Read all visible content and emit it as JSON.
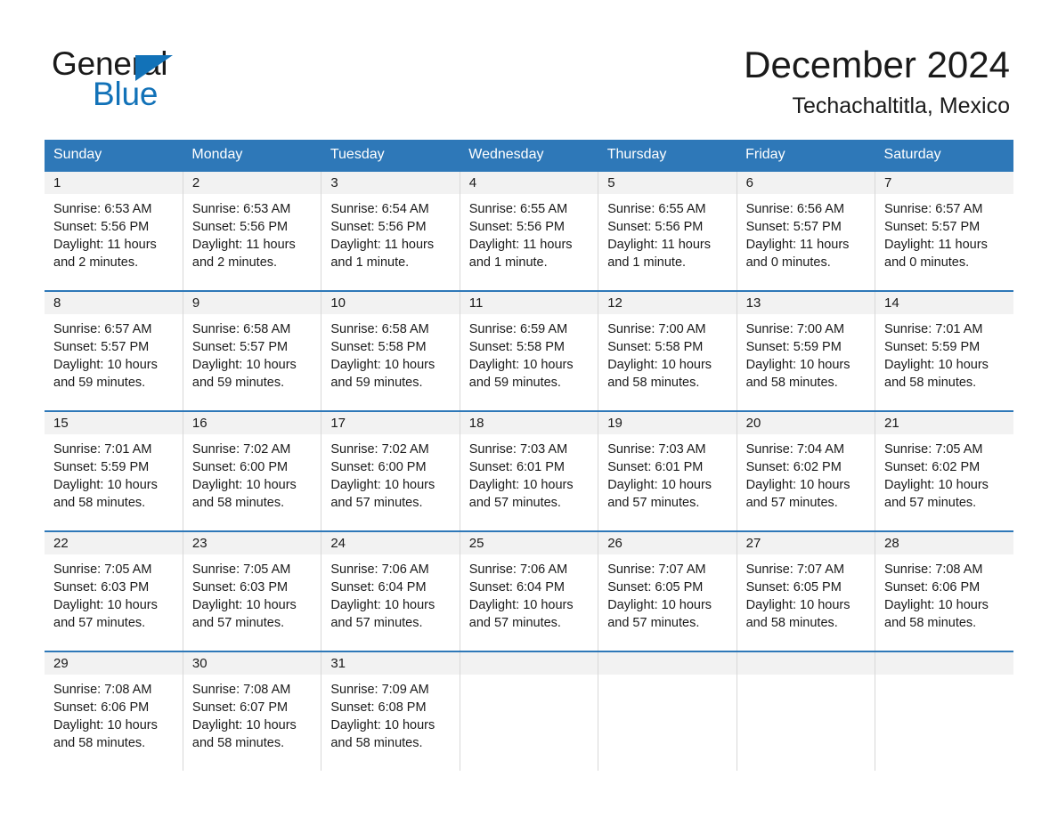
{
  "brand": {
    "name_part1": "General",
    "name_part2": "Blue",
    "logo_icon": "blue-triangle-icon"
  },
  "header": {
    "month_title": "December 2024",
    "location": "Techachaltitla, Mexico"
  },
  "colors": {
    "header_blue": "#2e78b8",
    "brand_blue": "#1272b8",
    "daynum_band": "#f2f2f2",
    "text": "#1a1a1a",
    "cell_divider": "#d8d8d8"
  },
  "weekday_headers": [
    "Sunday",
    "Monday",
    "Tuesday",
    "Wednesday",
    "Thursday",
    "Friday",
    "Saturday"
  ],
  "labels": {
    "sunrise_prefix": "Sunrise:",
    "sunset_prefix": "Sunset:",
    "daylight_prefix": "Daylight:"
  },
  "weeks": [
    [
      {
        "day": "1",
        "sunrise": "Sunrise: 6:53 AM",
        "sunset": "Sunset: 5:56 PM",
        "daylight_l1": "Daylight: 11 hours",
        "daylight_l2": "and 2 minutes."
      },
      {
        "day": "2",
        "sunrise": "Sunrise: 6:53 AM",
        "sunset": "Sunset: 5:56 PM",
        "daylight_l1": "Daylight: 11 hours",
        "daylight_l2": "and 2 minutes."
      },
      {
        "day": "3",
        "sunrise": "Sunrise: 6:54 AM",
        "sunset": "Sunset: 5:56 PM",
        "daylight_l1": "Daylight: 11 hours",
        "daylight_l2": "and 1 minute."
      },
      {
        "day": "4",
        "sunrise": "Sunrise: 6:55 AM",
        "sunset": "Sunset: 5:56 PM",
        "daylight_l1": "Daylight: 11 hours",
        "daylight_l2": "and 1 minute."
      },
      {
        "day": "5",
        "sunrise": "Sunrise: 6:55 AM",
        "sunset": "Sunset: 5:56 PM",
        "daylight_l1": "Daylight: 11 hours",
        "daylight_l2": "and 1 minute."
      },
      {
        "day": "6",
        "sunrise": "Sunrise: 6:56 AM",
        "sunset": "Sunset: 5:57 PM",
        "daylight_l1": "Daylight: 11 hours",
        "daylight_l2": "and 0 minutes."
      },
      {
        "day": "7",
        "sunrise": "Sunrise: 6:57 AM",
        "sunset": "Sunset: 5:57 PM",
        "daylight_l1": "Daylight: 11 hours",
        "daylight_l2": "and 0 minutes."
      }
    ],
    [
      {
        "day": "8",
        "sunrise": "Sunrise: 6:57 AM",
        "sunset": "Sunset: 5:57 PM",
        "daylight_l1": "Daylight: 10 hours",
        "daylight_l2": "and 59 minutes."
      },
      {
        "day": "9",
        "sunrise": "Sunrise: 6:58 AM",
        "sunset": "Sunset: 5:57 PM",
        "daylight_l1": "Daylight: 10 hours",
        "daylight_l2": "and 59 minutes."
      },
      {
        "day": "10",
        "sunrise": "Sunrise: 6:58 AM",
        "sunset": "Sunset: 5:58 PM",
        "daylight_l1": "Daylight: 10 hours",
        "daylight_l2": "and 59 minutes."
      },
      {
        "day": "11",
        "sunrise": "Sunrise: 6:59 AM",
        "sunset": "Sunset: 5:58 PM",
        "daylight_l1": "Daylight: 10 hours",
        "daylight_l2": "and 59 minutes."
      },
      {
        "day": "12",
        "sunrise": "Sunrise: 7:00 AM",
        "sunset": "Sunset: 5:58 PM",
        "daylight_l1": "Daylight: 10 hours",
        "daylight_l2": "and 58 minutes."
      },
      {
        "day": "13",
        "sunrise": "Sunrise: 7:00 AM",
        "sunset": "Sunset: 5:59 PM",
        "daylight_l1": "Daylight: 10 hours",
        "daylight_l2": "and 58 minutes."
      },
      {
        "day": "14",
        "sunrise": "Sunrise: 7:01 AM",
        "sunset": "Sunset: 5:59 PM",
        "daylight_l1": "Daylight: 10 hours",
        "daylight_l2": "and 58 minutes."
      }
    ],
    [
      {
        "day": "15",
        "sunrise": "Sunrise: 7:01 AM",
        "sunset": "Sunset: 5:59 PM",
        "daylight_l1": "Daylight: 10 hours",
        "daylight_l2": "and 58 minutes."
      },
      {
        "day": "16",
        "sunrise": "Sunrise: 7:02 AM",
        "sunset": "Sunset: 6:00 PM",
        "daylight_l1": "Daylight: 10 hours",
        "daylight_l2": "and 58 minutes."
      },
      {
        "day": "17",
        "sunrise": "Sunrise: 7:02 AM",
        "sunset": "Sunset: 6:00 PM",
        "daylight_l1": "Daylight: 10 hours",
        "daylight_l2": "and 57 minutes."
      },
      {
        "day": "18",
        "sunrise": "Sunrise: 7:03 AM",
        "sunset": "Sunset: 6:01 PM",
        "daylight_l1": "Daylight: 10 hours",
        "daylight_l2": "and 57 minutes."
      },
      {
        "day": "19",
        "sunrise": "Sunrise: 7:03 AM",
        "sunset": "Sunset: 6:01 PM",
        "daylight_l1": "Daylight: 10 hours",
        "daylight_l2": "and 57 minutes."
      },
      {
        "day": "20",
        "sunrise": "Sunrise: 7:04 AM",
        "sunset": "Sunset: 6:02 PM",
        "daylight_l1": "Daylight: 10 hours",
        "daylight_l2": "and 57 minutes."
      },
      {
        "day": "21",
        "sunrise": "Sunrise: 7:05 AM",
        "sunset": "Sunset: 6:02 PM",
        "daylight_l1": "Daylight: 10 hours",
        "daylight_l2": "and 57 minutes."
      }
    ],
    [
      {
        "day": "22",
        "sunrise": "Sunrise: 7:05 AM",
        "sunset": "Sunset: 6:03 PM",
        "daylight_l1": "Daylight: 10 hours",
        "daylight_l2": "and 57 minutes."
      },
      {
        "day": "23",
        "sunrise": "Sunrise: 7:05 AM",
        "sunset": "Sunset: 6:03 PM",
        "daylight_l1": "Daylight: 10 hours",
        "daylight_l2": "and 57 minutes."
      },
      {
        "day": "24",
        "sunrise": "Sunrise: 7:06 AM",
        "sunset": "Sunset: 6:04 PM",
        "daylight_l1": "Daylight: 10 hours",
        "daylight_l2": "and 57 minutes."
      },
      {
        "day": "25",
        "sunrise": "Sunrise: 7:06 AM",
        "sunset": "Sunset: 6:04 PM",
        "daylight_l1": "Daylight: 10 hours",
        "daylight_l2": "and 57 minutes."
      },
      {
        "day": "26",
        "sunrise": "Sunrise: 7:07 AM",
        "sunset": "Sunset: 6:05 PM",
        "daylight_l1": "Daylight: 10 hours",
        "daylight_l2": "and 57 minutes."
      },
      {
        "day": "27",
        "sunrise": "Sunrise: 7:07 AM",
        "sunset": "Sunset: 6:05 PM",
        "daylight_l1": "Daylight: 10 hours",
        "daylight_l2": "and 58 minutes."
      },
      {
        "day": "28",
        "sunrise": "Sunrise: 7:08 AM",
        "sunset": "Sunset: 6:06 PM",
        "daylight_l1": "Daylight: 10 hours",
        "daylight_l2": "and 58 minutes."
      }
    ],
    [
      {
        "day": "29",
        "sunrise": "Sunrise: 7:08 AM",
        "sunset": "Sunset: 6:06 PM",
        "daylight_l1": "Daylight: 10 hours",
        "daylight_l2": "and 58 minutes."
      },
      {
        "day": "30",
        "sunrise": "Sunrise: 7:08 AM",
        "sunset": "Sunset: 6:07 PM",
        "daylight_l1": "Daylight: 10 hours",
        "daylight_l2": "and 58 minutes."
      },
      {
        "day": "31",
        "sunrise": "Sunrise: 7:09 AM",
        "sunset": "Sunset: 6:08 PM",
        "daylight_l1": "Daylight: 10 hours",
        "daylight_l2": "and 58 minutes."
      },
      {
        "day": "",
        "sunrise": "",
        "sunset": "",
        "daylight_l1": "",
        "daylight_l2": ""
      },
      {
        "day": "",
        "sunrise": "",
        "sunset": "",
        "daylight_l1": "",
        "daylight_l2": ""
      },
      {
        "day": "",
        "sunrise": "",
        "sunset": "",
        "daylight_l1": "",
        "daylight_l2": ""
      },
      {
        "day": "",
        "sunrise": "",
        "sunset": "",
        "daylight_l1": "",
        "daylight_l2": ""
      }
    ]
  ]
}
